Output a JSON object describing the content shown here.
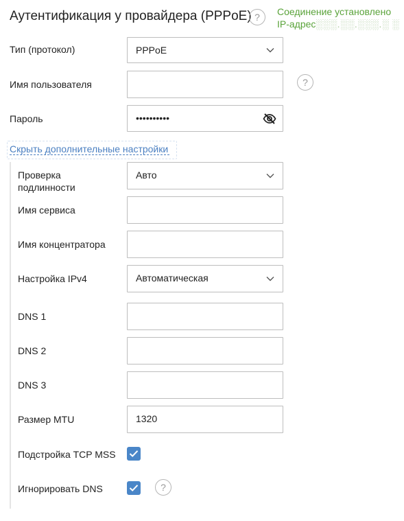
{
  "header": {
    "title": "Аутентификация у провайдера (PPPoE)",
    "status_line1": "Соединение установлено",
    "status_ip_label": "IP-адрес",
    "status_ip_value": "░░░.░░.░░░.░ ░"
  },
  "fields": {
    "protocol_label": "Тип (протокол)",
    "protocol_value": "PPPoE",
    "username_label": "Имя пользователя",
    "username_value": "",
    "password_label": "Пароль",
    "password_value": "••••••••••",
    "advanced_link": "Скрыть дополнительные настройки",
    "auth_label_1": "Проверка",
    "auth_label_2": "подлинности",
    "auth_value": "Авто",
    "service_label": "Имя сервиса",
    "service_value": "",
    "concentrator_label": "Имя концентратора",
    "concentrator_value": "",
    "ipv4_label": "Настройка IPv4",
    "ipv4_value": "Автоматическая",
    "dns1_label": "DNS 1",
    "dns2_label": "DNS 2",
    "dns3_label": "DNS 3",
    "mtu_label": "Размер MTU",
    "mtu_value": "1320",
    "tcp_mss_label": "Подстройка TCP MSS",
    "tcp_mss_checked": true,
    "ignore_dns_label": "Игнорировать DNS",
    "ignore_dns_checked": true
  },
  "icons": {
    "help": "question-circle-icon",
    "chevron": "chevron-down-icon",
    "eye": "eye-off-icon",
    "check": "checkmark-icon"
  },
  "colors": {
    "status_green": "#5aa33a",
    "link_blue": "#4a7fc1",
    "checkbox_blue": "#4a86c8",
    "border": "#bdbdbd"
  }
}
